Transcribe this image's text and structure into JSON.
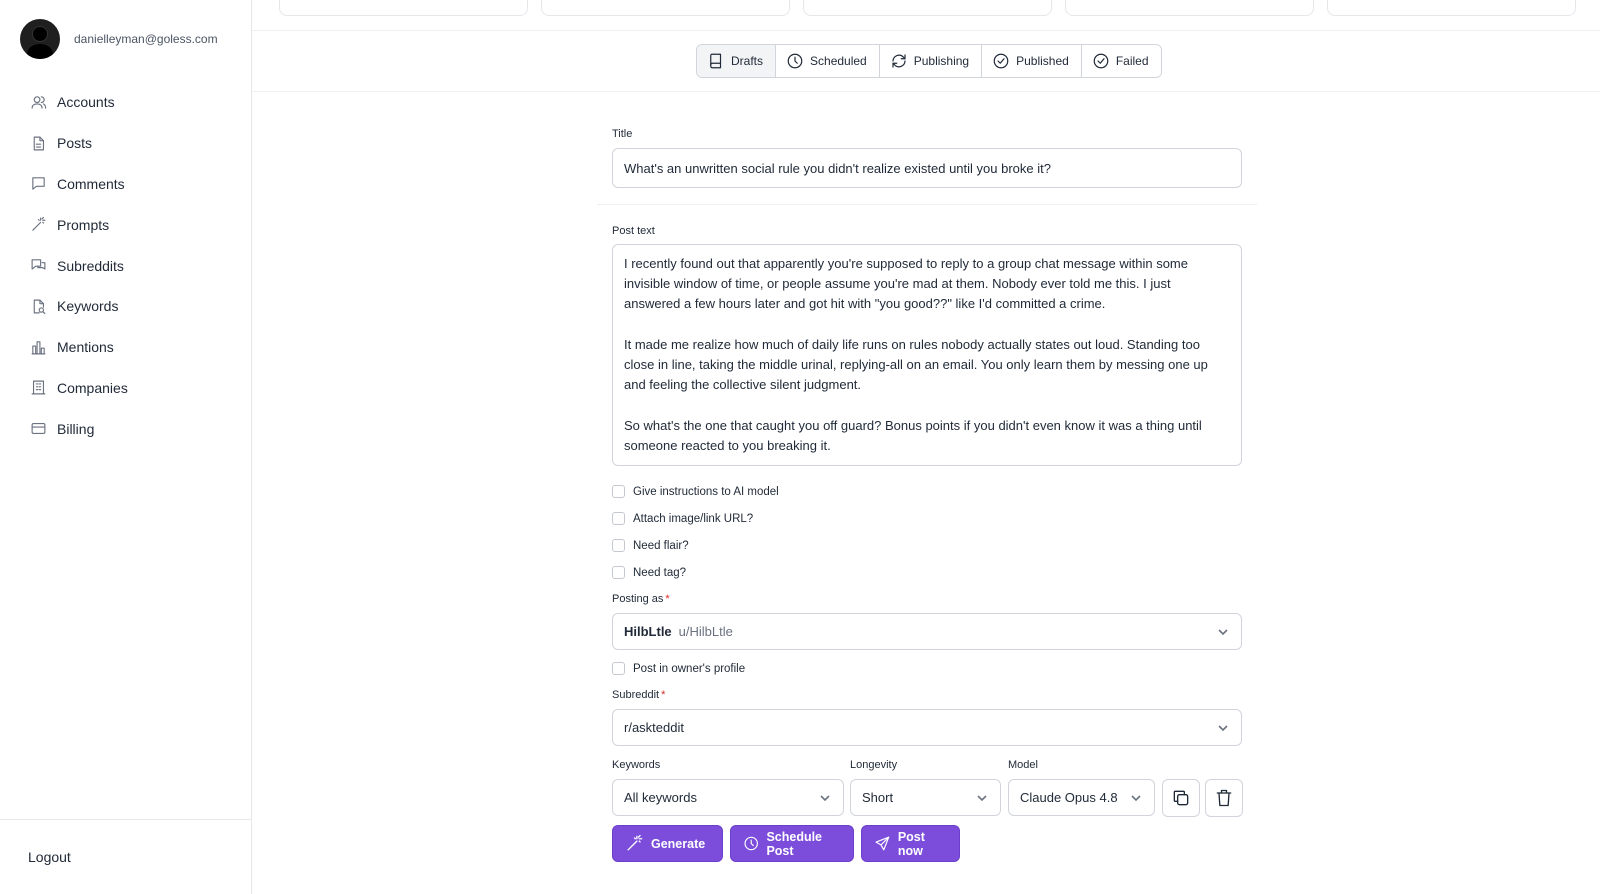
{
  "user": {
    "email": "danielleyman@goless.com"
  },
  "sidebar": {
    "items": [
      {
        "label": "Accounts",
        "icon": "users-icon"
      },
      {
        "label": "Posts",
        "icon": "document-icon"
      },
      {
        "label": "Comments",
        "icon": "comment-icon"
      },
      {
        "label": "Prompts",
        "icon": "wand-icon"
      },
      {
        "label": "Subreddits",
        "icon": "chat-bubbles-icon"
      },
      {
        "label": "Keywords",
        "icon": "file-search-icon"
      },
      {
        "label": "Mentions",
        "icon": "bar-chart-icon"
      },
      {
        "label": "Companies",
        "icon": "building-icon"
      },
      {
        "label": "Billing",
        "icon": "credit-card-icon"
      }
    ],
    "logout_label": "Logout"
  },
  "tabs": [
    {
      "label": "Drafts",
      "icon": "book-icon",
      "active": true
    },
    {
      "label": "Scheduled",
      "icon": "clock-icon",
      "active": false
    },
    {
      "label": "Publishing",
      "icon": "refresh-icon",
      "active": false
    },
    {
      "label": "Published",
      "icon": "check-circle-icon",
      "active": false
    },
    {
      "label": "Failed",
      "icon": "check-circle-icon",
      "active": false
    }
  ],
  "form": {
    "title_label": "Title",
    "title_value": "What's an unwritten social rule you didn't realize existed until you broke it?",
    "post_text_label": "Post text",
    "post_text_paragraphs": [
      "I recently found out that apparently you're supposed to reply to a group chat message within some invisible window of time, or people assume you're mad at them. Nobody ever told me this. I just answered a few hours later and got hit with \"you good??\" like I'd committed a crime.",
      "It made me realize how much of daily life runs on rules nobody actually states out loud. Standing too close in line, taking the middle urinal, replying-all on an email. You only learn them by messing one up and feeling the collective silent judgment.",
      "So what's the one that caught you off guard? Bonus points if you didn't even know it was a thing until someone reacted to you breaking it."
    ],
    "checkboxes": [
      {
        "label": "Give instructions to AI model",
        "checked": false
      },
      {
        "label": "Attach image/link URL?",
        "checked": false
      },
      {
        "label": "Need flair?",
        "checked": false
      },
      {
        "label": "Need tag?",
        "checked": false
      }
    ],
    "posting_as_label": "Posting as",
    "posting_as_name": "HilbLtle",
    "posting_as_handle": "u/HilbLtle",
    "owner_profile_label": "Post in owner's profile",
    "subreddit_label": "Subreddit",
    "subreddit_value": "r/askteddit",
    "keywords_label": "Keywords",
    "keywords_value": "All keywords",
    "longevity_label": "Longevity",
    "longevity_value": "Short",
    "model_label": "Model",
    "model_value": "Claude Opus 4.8",
    "required_marker": "*"
  },
  "actions": {
    "generate_label": "Generate",
    "schedule_label": "Schedule Post",
    "post_now_label": "Post now"
  },
  "colors": {
    "accent": "#7c4ddb",
    "border": "#d1d5db",
    "required": "#dc2626"
  }
}
